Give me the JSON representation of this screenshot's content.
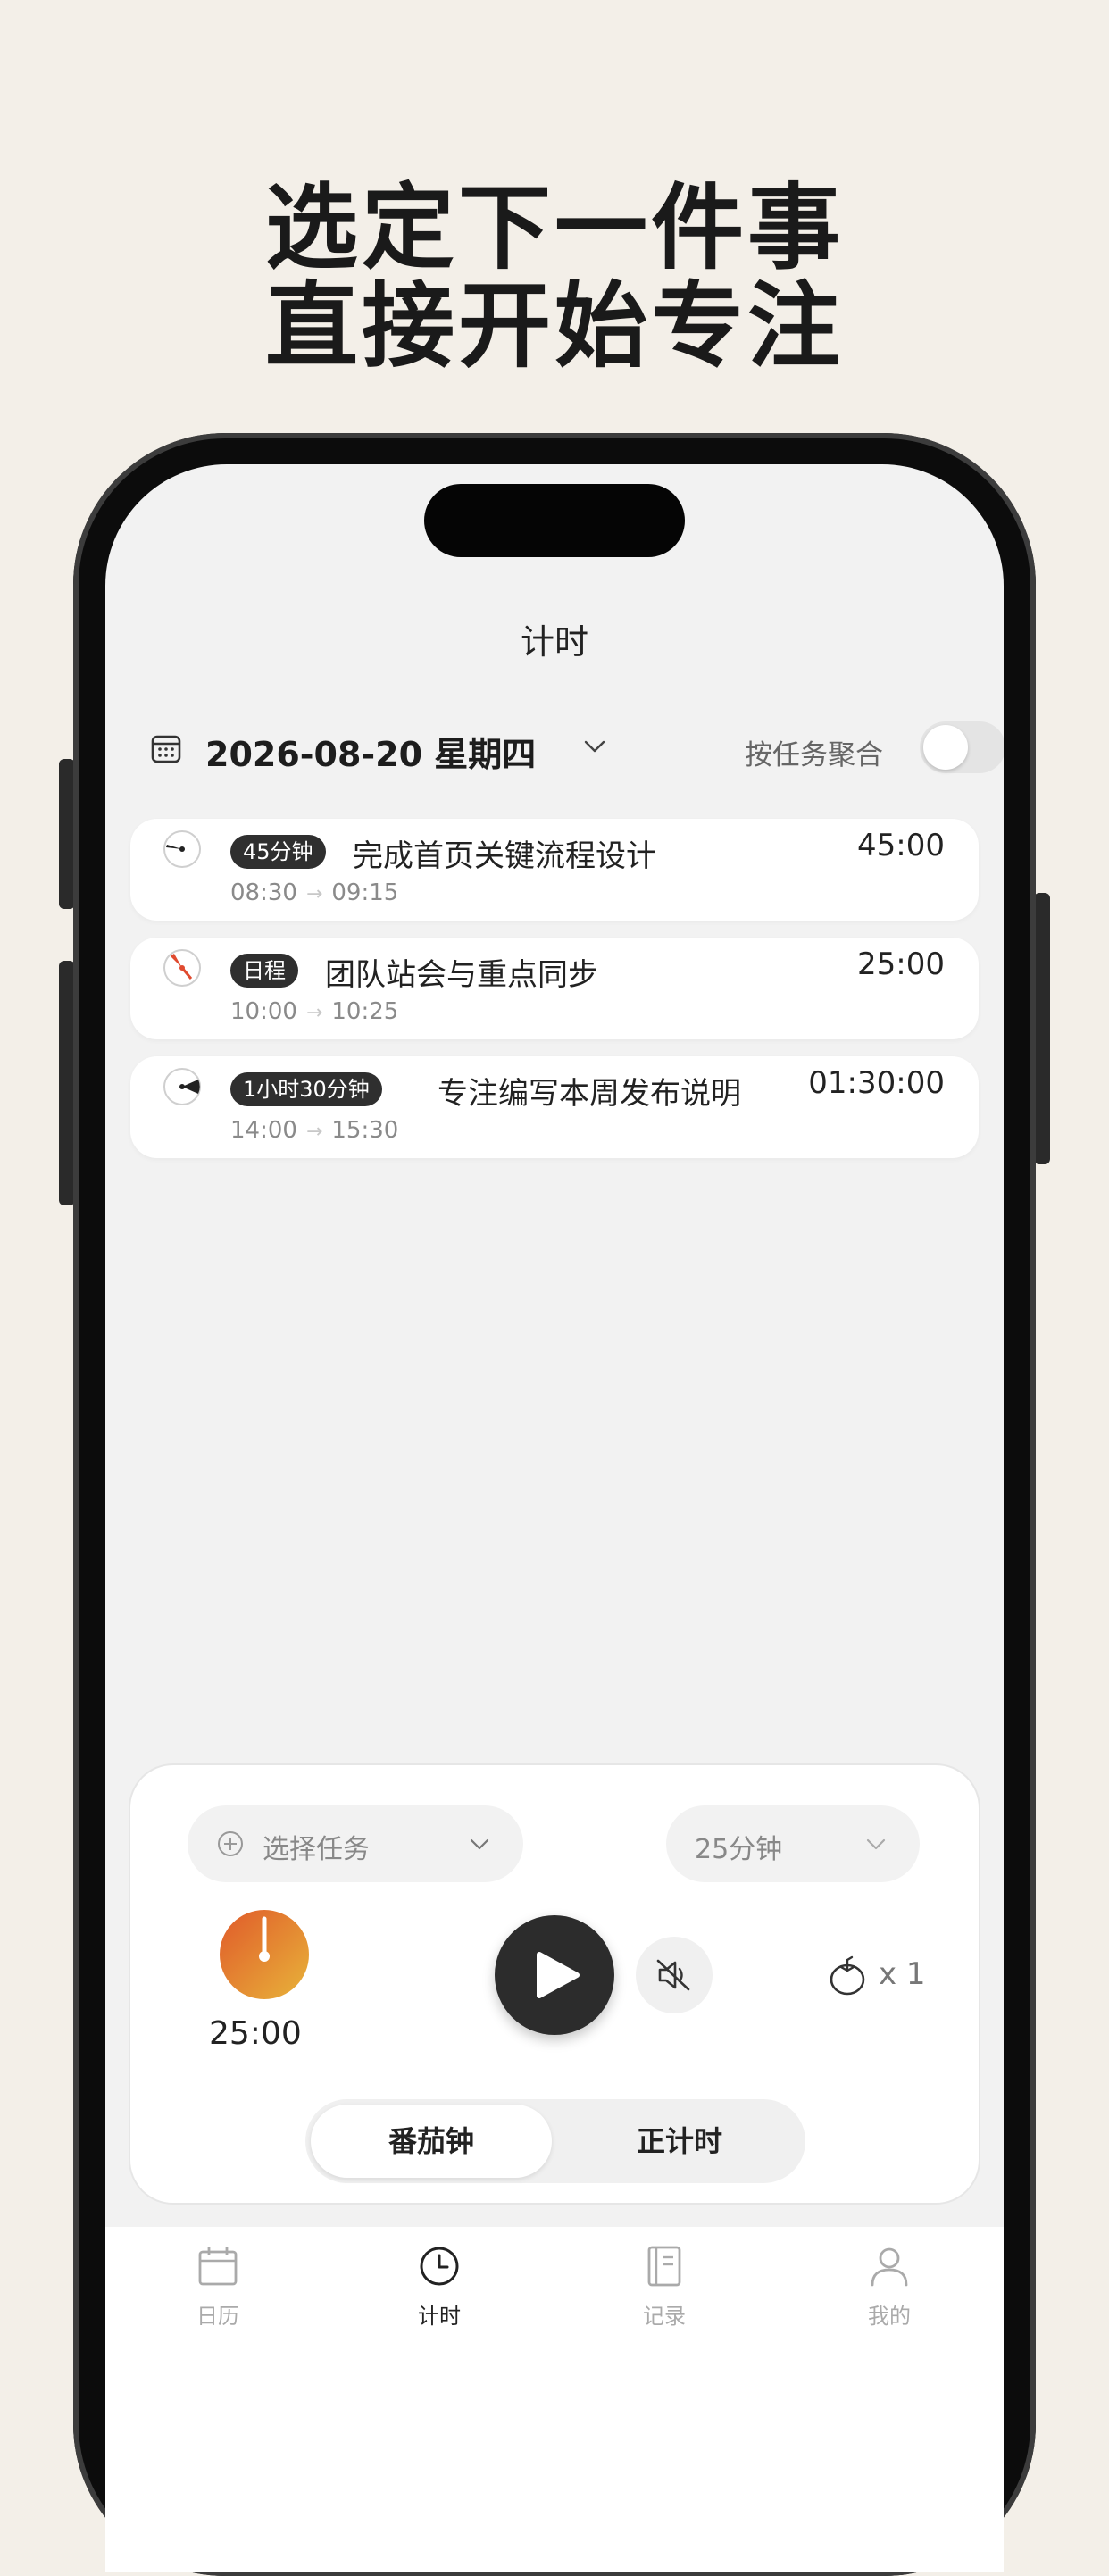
{
  "headline": {
    "line1": "选定下一件事",
    "line2": "直接开始专注"
  },
  "nav": {
    "title": "计时"
  },
  "date_bar": {
    "date_label": "2026-08-20 星期四",
    "group_label": "按任务聚合",
    "group_toggle_on": false
  },
  "tasks": [
    {
      "badge": "45分钟",
      "title": "完成首页关键流程设计",
      "start": "08:30",
      "end": "09:15",
      "duration": "45:00",
      "dial_color": "#222222"
    },
    {
      "badge": "日程",
      "title": "团队站会与重点同步",
      "start": "10:00",
      "end": "10:25",
      "duration": "25:00",
      "dial_color": "#e04a2f"
    },
    {
      "badge": "1小时30分钟",
      "title": "专注编写本周发布说明",
      "start": "14:00",
      "end": "15:30",
      "duration": "01:30:00",
      "dial_color": "#222222"
    }
  ],
  "timer": {
    "select_task_label": "选择任务",
    "duration_select": "25分钟",
    "dial_time": "25:00",
    "tomato_count": "x 1",
    "modes": {
      "active": "番茄钟",
      "other": "正计时"
    },
    "dial_gradient": [
      "#e05a2a",
      "#e8b43a"
    ]
  },
  "tabbar": {
    "calendar": "日历",
    "timer": "计时",
    "records": "记录",
    "me": "我的"
  }
}
